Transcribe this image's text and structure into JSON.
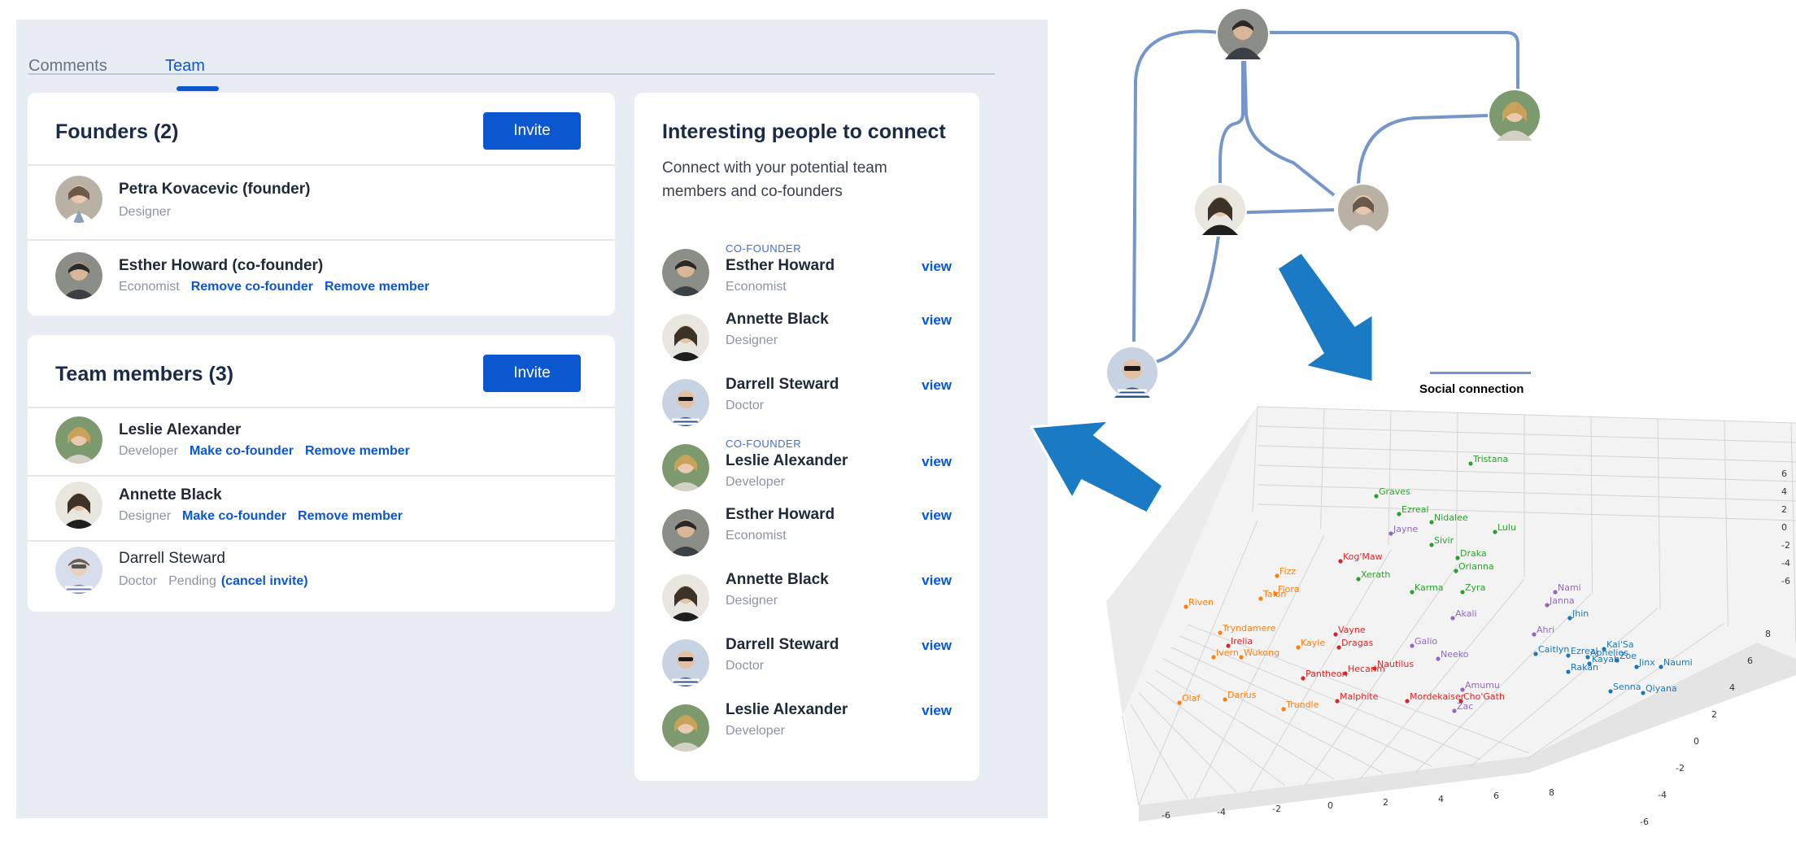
{
  "tabs": [
    {
      "label": "Comments"
    },
    {
      "label": "Team"
    }
  ],
  "founders": {
    "title": "Founders (2)",
    "invite_label": "Invite",
    "people": [
      {
        "name": "Petra Kovacevic (founder)",
        "role": "Designer",
        "actions": []
      },
      {
        "name": "Esther Howard (co-founder)",
        "role": "Economist",
        "actions": [
          "Remove co-founder",
          "Remove member"
        ]
      }
    ]
  },
  "members": {
    "title": "Team members (3)",
    "invite_label": "Invite",
    "people": [
      {
        "name": "Leslie Alexander",
        "role": "Developer",
        "actions": [
          "Make co-founder",
          "Remove member"
        ]
      },
      {
        "name": "Annette Black",
        "role": "Designer",
        "actions": [
          "Make co-founder",
          "Remove member"
        ]
      },
      {
        "name": "Darrell Steward",
        "role": "Doctor",
        "status": "Pending",
        "cancel": "(cancel invite)"
      }
    ]
  },
  "suggestions": {
    "title": "Interesting people to connect",
    "description": "Connect with your potential team members and co-founders",
    "view_label": "view",
    "items": [
      {
        "tag": "CO-FOUNDER",
        "name": "Esther Howard",
        "role": "Economist"
      },
      {
        "tag": "",
        "name": "Annette Black",
        "role": "Designer"
      },
      {
        "tag": "",
        "name": "Darrell Steward",
        "role": "Doctor"
      },
      {
        "tag": "CO-FOUNDER",
        "name": "Leslie Alexander",
        "role": "Developer"
      },
      {
        "tag": "",
        "name": "Esther Howard",
        "role": "Economist"
      },
      {
        "tag": "",
        "name": "Annette Black",
        "role": "Designer"
      },
      {
        "tag": "",
        "name": "Darrell Steward",
        "role": "Doctor"
      },
      {
        "tag": "",
        "name": "Leslie Alexander",
        "role": "Developer"
      }
    ]
  },
  "legend": {
    "label": "Social connection"
  },
  "colors": {
    "accent": "#0b57d0",
    "panel": "#e8edf3",
    "edge": "#7496c9",
    "arrow": "#1a7ac4"
  },
  "embedding_plot": {
    "x_ticks": [
      "-6",
      "-4",
      "-2",
      "0",
      "2",
      "4",
      "6",
      "8"
    ],
    "y_ticks": [
      "-6",
      "-4",
      "-2",
      "0",
      "2",
      "4",
      "6",
      "8"
    ],
    "z_ticks": [
      "6",
      "4",
      "2",
      "0",
      "-2",
      "-4",
      "-6"
    ],
    "labels": [
      {
        "t": "Tristana",
        "c": "#2ca02c"
      },
      {
        "t": "Graves",
        "c": "#2ca02c"
      },
      {
        "t": "Ezreal",
        "c": "#2ca02c"
      },
      {
        "t": "Nidalee",
        "c": "#2ca02c"
      },
      {
        "t": "Jayne",
        "c": "#9467bd"
      },
      {
        "t": "Lulu",
        "c": "#2ca02c"
      },
      {
        "t": "Sivir",
        "c": "#2ca02c"
      },
      {
        "t": "Draka",
        "c": "#2ca02c"
      },
      {
        "t": "Kog'Maw",
        "c": "#d62728"
      },
      {
        "t": "Orianna",
        "c": "#2ca02c"
      },
      {
        "t": "Xerath",
        "c": "#2ca02c"
      },
      {
        "t": "Fizz",
        "c": "#ff7f0e"
      },
      {
        "t": "Talon",
        "c": "#ff7f0e"
      },
      {
        "t": "Fiora",
        "c": "#ff7f0e"
      },
      {
        "t": "Riven",
        "c": "#ff7f0e"
      },
      {
        "t": "Zyra",
        "c": "#2ca02c"
      },
      {
        "t": "Karma",
        "c": "#2ca02c"
      },
      {
        "t": "Nami",
        "c": "#9467bd"
      },
      {
        "t": "Janna",
        "c": "#9467bd"
      },
      {
        "t": "Jhin",
        "c": "#1f77b4"
      },
      {
        "t": "Akali",
        "c": "#9467bd"
      },
      {
        "t": "Tryndamere",
        "c": "#ff7f0e"
      },
      {
        "t": "Irelia",
        "c": "#d62728"
      },
      {
        "t": "Wukong",
        "c": "#ff7f0e"
      },
      {
        "t": "Vayne",
        "c": "#d62728"
      },
      {
        "t": "Dragas",
        "c": "#d62728"
      },
      {
        "t": "Galio",
        "c": "#9467bd"
      },
      {
        "t": "Caitlyn",
        "c": "#1f77b4"
      },
      {
        "t": "Kai'Sa",
        "c": "#1f77b4"
      },
      {
        "t": "Zoe",
        "c": "#1f77b4"
      },
      {
        "t": "Neeko",
        "c": "#9467bd"
      },
      {
        "t": "Nautilus",
        "c": "#d62728"
      },
      {
        "t": "Hecarim",
        "c": "#d62728"
      },
      {
        "t": "Ahri",
        "c": "#9467bd"
      },
      {
        "t": "Rakan",
        "c": "#1f77b4"
      },
      {
        "t": "Kayle",
        "c": "#ff7f0e"
      },
      {
        "t": "Pantheon",
        "c": "#d62728"
      },
      {
        "t": "Olaf",
        "c": "#ff7f0e"
      },
      {
        "t": "Darius",
        "c": "#ff7f0e"
      },
      {
        "t": "Trundle",
        "c": "#ff7f0e"
      },
      {
        "t": "Malphite",
        "c": "#d62728"
      },
      {
        "t": "Mordekaiser",
        "c": "#d62728"
      },
      {
        "t": "Cho'Gath",
        "c": "#d62728"
      },
      {
        "t": "Amumu",
        "c": "#9467bd"
      },
      {
        "t": "Zac",
        "c": "#9467bd"
      },
      {
        "t": "Senna",
        "c": "#1f77b4"
      },
      {
        "t": "Qiyana",
        "c": "#1f77b4"
      },
      {
        "t": "Aphelios",
        "c": "#1f77b4"
      },
      {
        "t": "Ezreal",
        "c": "#1f77b4"
      },
      {
        "t": "Jinx",
        "c": "#1f77b4"
      },
      {
        "t": "Naumi",
        "c": "#1f77b4"
      },
      {
        "t": "Kayah",
        "c": "#1f77b4"
      },
      {
        "t": "Ivern",
        "c": "#ff7f0e"
      }
    ]
  }
}
